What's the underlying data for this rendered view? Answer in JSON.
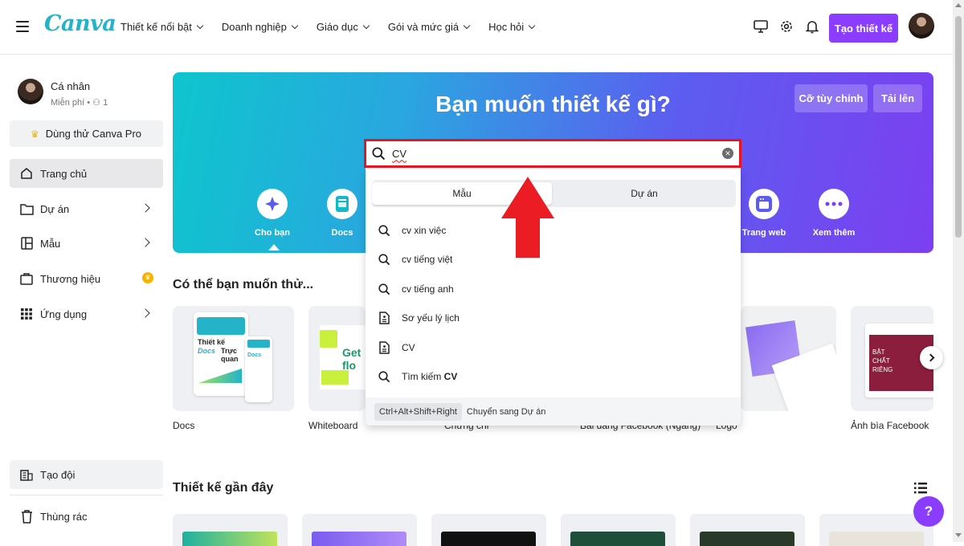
{
  "brand": {
    "logo_text": "Canva",
    "accent": "#8b3dff",
    "teal": "#24b3c9"
  },
  "topnav": {
    "items": [
      {
        "label": "Thiết kế nổi bật"
      },
      {
        "label": "Doanh nghiệp"
      },
      {
        "label": "Giáo dục"
      },
      {
        "label": "Gói và mức giá"
      },
      {
        "label": "Học hỏi"
      }
    ],
    "create_label": "Tạo thiết kế",
    "icons": [
      "desktop-icon",
      "gear-icon",
      "bell-icon"
    ]
  },
  "sidebar": {
    "profile_name": "Cá nhân",
    "profile_sub": "Miễn phí • ⚇ 1",
    "pro_label": "Dùng thử Canva Pro",
    "items": [
      {
        "label": "Trang chủ",
        "icon": "home-icon"
      },
      {
        "label": "Dự án",
        "icon": "folder-icon"
      },
      {
        "label": "Mẫu",
        "icon": "template-icon"
      },
      {
        "label": "Thương hiệu",
        "icon": "brand-icon"
      },
      {
        "label": "Ứng dụng",
        "icon": "apps-grid-icon"
      }
    ],
    "bottom_items": [
      {
        "label": "Tạo đội",
        "icon": "team-icon"
      },
      {
        "label": "Thùng rác",
        "icon": "trash-icon"
      }
    ]
  },
  "hero": {
    "title": "Bạn muốn thiết kế gì?",
    "custom_size_label": "Cỡ tùy chỉnh",
    "upload_label": "Tải lên",
    "categories": [
      {
        "label": "Cho bạn",
        "icon": "sparkle-icon"
      },
      {
        "label": "Docs",
        "icon": "docs-icon"
      },
      {
        "label": "Trang web",
        "icon": "website-icon"
      },
      {
        "label": "Xem thêm",
        "icon": "more-icon"
      }
    ]
  },
  "search": {
    "value": "CV",
    "tabs": [
      {
        "label": "Mẫu"
      },
      {
        "label": "Dự án"
      }
    ],
    "suggestions": [
      {
        "text": "cv xin việc",
        "icon": "search-icon"
      },
      {
        "text": "cv tiếng việt",
        "icon": "search-icon"
      },
      {
        "text": "cv tiếng anh",
        "icon": "search-icon"
      },
      {
        "text": "Sơ yếu lý lịch",
        "icon": "document-icon"
      },
      {
        "text": "CV",
        "icon": "document-icon"
      },
      {
        "text_prefix": "Tìm kiếm ",
        "text_bold": "CV",
        "icon": "search-icon"
      }
    ],
    "shortcut": "Ctrl+Alt+Shift+Right",
    "shortcut_hint": "Chuyển sang Dự án"
  },
  "suggest_section": {
    "title": "Có thể bạn muốn thử...",
    "cards": [
      {
        "label": "Docs"
      },
      {
        "label": "Whiteboard"
      },
      {
        "label": "Chứng chỉ"
      },
      {
        "label": "Bài đăng Facebook (Ngang)"
      },
      {
        "label": "Logo"
      },
      {
        "label": "Ảnh bìa Facebook"
      }
    ],
    "docs_thumb": {
      "title_a": "Thiết kế",
      "title_b": "Docs",
      "title_c": "Trực quan"
    },
    "whiteboard_thumb": {
      "text": "Get flo"
    },
    "cover_thumb": {
      "line1": "BẬT",
      "line2": "CHẤT",
      "line3": "RIÊNG"
    }
  },
  "recent_section": {
    "title": "Thiết kế gần đây"
  },
  "help_label": "?"
}
